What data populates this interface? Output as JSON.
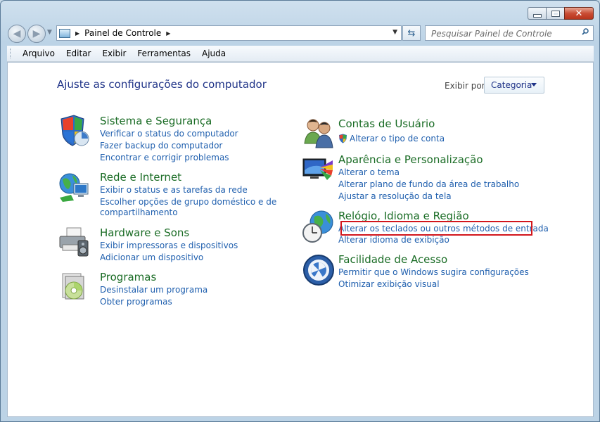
{
  "address": {
    "crumb": "Painel de Controle"
  },
  "search": {
    "placeholder": "Pesquisar Painel de Controle"
  },
  "menu": [
    "Arquivo",
    "Editar",
    "Exibir",
    "Ferramentas",
    "Ajuda"
  ],
  "header": {
    "title": "Ajuste as configurações do computador",
    "view_by_label": "Exibir por:",
    "view_by_value": "Categoria"
  },
  "categories": [
    {
      "title": "Sistema e Segurança",
      "links": [
        "Verificar o status do computador",
        "Fazer backup do computador",
        "Encontrar e corrigir problemas"
      ]
    },
    {
      "title": "Rede e Internet",
      "links": [
        "Exibir o status e as tarefas da rede",
        "Escolher opções de grupo doméstico e de",
        "compartilhamento"
      ]
    },
    {
      "title": "Hardware e Sons",
      "links": [
        "Exibir impressoras e dispositivos",
        "Adicionar um dispositivo"
      ]
    },
    {
      "title": "Programas",
      "links": [
        "Desinstalar um programa",
        "Obter programas"
      ]
    },
    {
      "title": "Contas de Usuário",
      "links": [
        "Alterar o tipo de conta"
      ]
    },
    {
      "title": "Aparência e Personalização",
      "links": [
        "Alterar o tema",
        "Alterar plano de fundo da área de trabalho",
        "Ajustar a resolução da tela"
      ]
    },
    {
      "title": "Relógio, Idioma e Região",
      "links": [
        "Alterar os teclados ou outros métodos de entrada",
        "Alterar idioma de exibição"
      ]
    },
    {
      "title": "Facilidade de Acesso",
      "links": [
        "Permitir que o Windows sugira configurações",
        "Otimizar exibição visual"
      ]
    }
  ],
  "colors": {
    "title_green": "#1a6c25",
    "link_blue": "#1f5fae",
    "heading_blue": "#1e3287",
    "highlight_red": "#d2161c"
  }
}
